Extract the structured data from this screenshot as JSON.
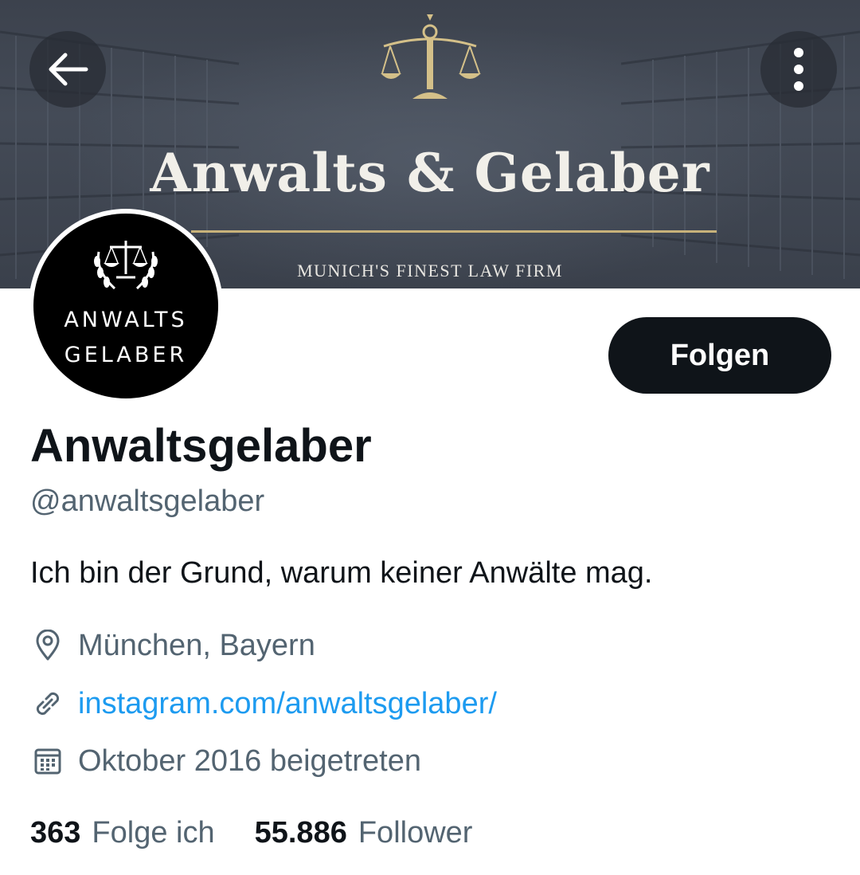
{
  "header": {
    "banner_title": "Anwalts & Gelaber",
    "banner_subtitle": "MUNICH'S FINEST LAW FIRM"
  },
  "avatar": {
    "line1": "ANWALTS",
    "line2": "GELABER"
  },
  "actions": {
    "follow_label": "Folgen"
  },
  "profile": {
    "display_name": "Anwaltsgelaber",
    "handle": "@anwaltsgelaber",
    "bio": "Ich bin der Grund, warum keiner Anwälte mag.",
    "location": "München, Bayern",
    "link": "instagram.com/anwaltsgelaber/",
    "joined": "Oktober 2016 beigetreten"
  },
  "stats": {
    "following_count": "363",
    "following_label": "Folge ich",
    "followers_count": "55.886",
    "followers_label": "Follower"
  },
  "colors": {
    "text_primary": "#0f1419",
    "text_secondary": "#536471",
    "link": "#1d9bf0",
    "gold": "#c8b27a"
  },
  "icons": [
    "back-arrow-icon",
    "more-vertical-icon",
    "scales-of-justice-icon",
    "location-pin-icon",
    "link-icon",
    "calendar-icon"
  ]
}
